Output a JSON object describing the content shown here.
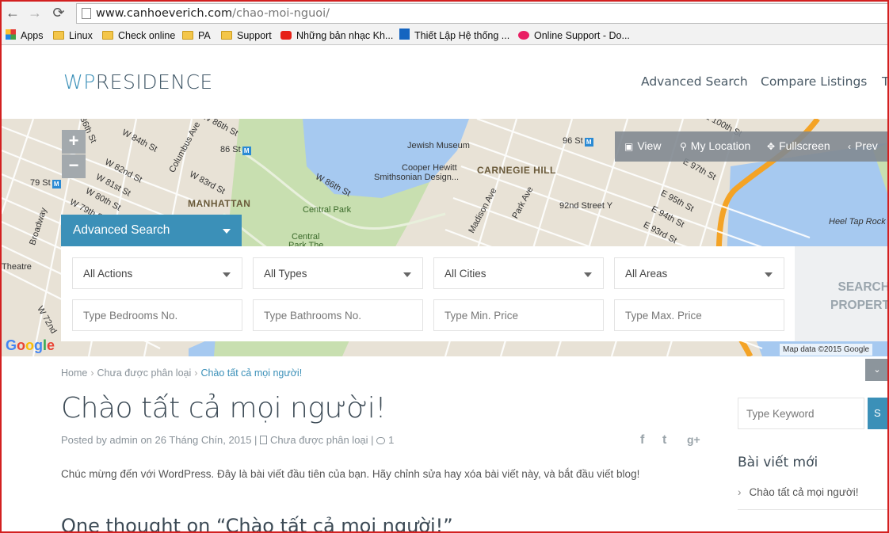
{
  "browser": {
    "url_domain": "www.canhoeverich.com",
    "url_path": "/chao-moi-nguoi/",
    "bookmarks": [
      "Apps",
      "Linux",
      "Check online",
      "PA",
      "Support",
      "Những bản nhạc Kh...",
      "Thiết Lập Hệ thống ...",
      "Online Support - Do..."
    ]
  },
  "site": {
    "logo_wp": "WP",
    "logo_rest": "RESIDENCE",
    "menu": [
      "Advanced Search",
      "Compare Listings",
      "T"
    ]
  },
  "map": {
    "zoom_in": "+",
    "zoom_out": "−",
    "toolbar": [
      "View",
      "My Location",
      "Fullscreen",
      "Prev"
    ],
    "labels": {
      "w86_1": "W 86th St",
      "w84": "W 84th St",
      "w82": "W 82nd St",
      "w81": "W 81st St",
      "w80": "W 80th St",
      "w79": "W 79th St",
      "w83": "W 83rd St",
      "w72": "W 72nd",
      "columbus": "Columbus Ave",
      "broadway": "Broadway",
      "manhattan": "MANHATTAN",
      "st86": "86 St",
      "st79": "79 St",
      "st96": "96 St",
      "jewish": "Jewish Museum",
      "cooper1": "Cooper Hewitt",
      "cooper2": "Smithsonian Design...",
      "carnegie": "CARNEGIE HILL",
      "w86_2": "W 86th St",
      "central_park": "Central Park",
      "central_park2a": "Central",
      "central_park2b": "Park The",
      "madison": "Madison Ave",
      "park": "Park Ave",
      "st92": "92nd Street Y",
      "e95": "E 95th St",
      "e94": "E 94th St",
      "e93": "E 93rd St",
      "e97": "E 97th St",
      "e100": "E 100th St",
      "heel": "Heel Tap Rock",
      "theatre": "Theatre",
      "google": "Google",
      "map_data": "Map data ©2015 Google"
    }
  },
  "search": {
    "tab_label": "Advanced Search",
    "selects": [
      "All Actions",
      "All Types",
      "All Cities",
      "All Areas"
    ],
    "inputs": [
      "Type Bedrooms No.",
      "Type Bathrooms No.",
      "Type Min. Price",
      "Type Max. Price"
    ],
    "button_line1": "SEARCH",
    "button_line2": "PROPERT"
  },
  "breadcrumb": [
    "Home",
    "Chưa được phân loại",
    "Chào tất cả mọi người!"
  ],
  "post": {
    "title": "Chào tất cả mọi người!",
    "meta_prefix": "Posted by admin on 26 Tháng Chín, 2015 |",
    "meta_category": "Chưa được phân loại |",
    "meta_comments": "1",
    "body": "Chúc mừng đến với WordPress. Đây là bài viết đầu tiên của bạn. Hãy chỉnh sửa hay xóa bài viết này, và bắt đầu viết blog!",
    "comments_title": "One thought on “Chào tất cả mọi người!”"
  },
  "share": {
    "facebook": "f",
    "twitter": "t",
    "gplus": "g+"
  },
  "sidebar": {
    "keyword_placeholder": "Type Keyword",
    "search_btn": "S",
    "widget_title": "Bài viết mới",
    "recent_posts": [
      "Chào tất cả mọi người!"
    ]
  }
}
